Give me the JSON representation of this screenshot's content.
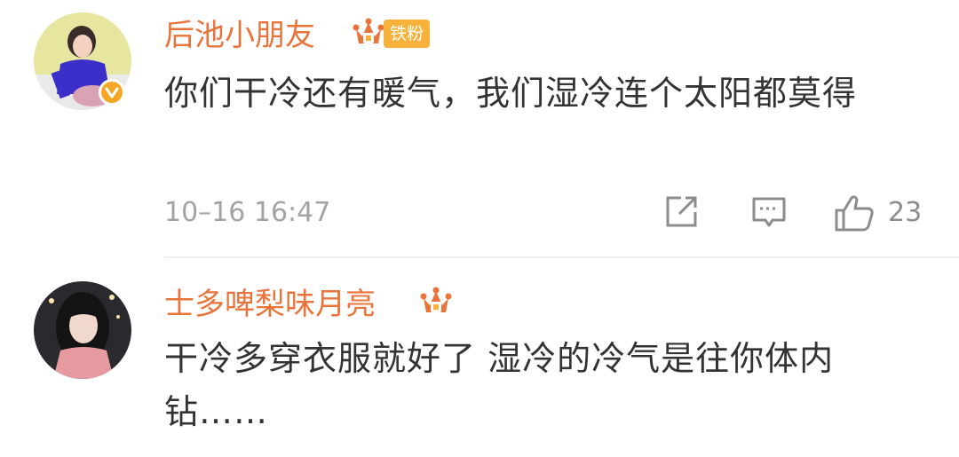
{
  "comments": [
    {
      "username": "后池小朋友",
      "fan_badge": "铁粉",
      "text": "你们干冷还有暖气，我们湿冷连个太阳都莫得",
      "time": "10–16 16:47",
      "likes": "23"
    },
    {
      "username": "士多啤梨味月亮",
      "text": "干冷多穿衣服就好了 湿冷的冷气是往你体内钻……"
    }
  ],
  "icons": {
    "crown": "crown-icon",
    "share": "share-icon",
    "reply": "reply-icon",
    "like": "thumbs-up-icon",
    "verified": "verified-badge-icon"
  },
  "colors": {
    "username": "#e8743b",
    "badge": "#f6b23a",
    "meta": "#a3a3a3",
    "text": "#333333"
  }
}
